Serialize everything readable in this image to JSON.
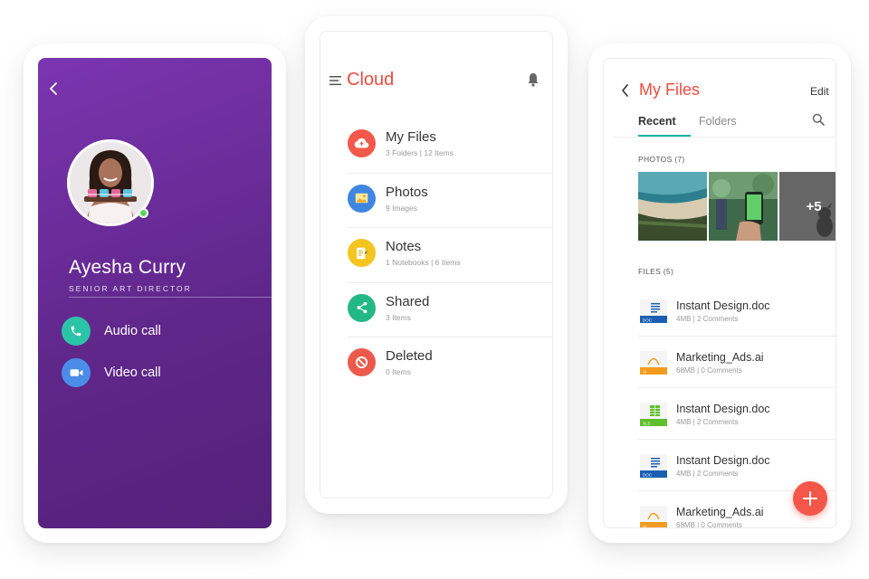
{
  "contact": {
    "name": "Ayesha Curry",
    "role": "SENIOR ART DIRECTOR",
    "online_color": "#5fd65b",
    "actions": [
      {
        "label": "Audio call",
        "icon": "phone-icon",
        "color": "#2cc4a7"
      },
      {
        "label": "Video call",
        "icon": "video-camera-icon",
        "color": "#4a8de8"
      }
    ]
  },
  "cloud": {
    "title": "Cloud",
    "accent": "#ef4b3f",
    "items": [
      {
        "name": "My Files",
        "details": "3 Folders  |  12 Items",
        "icon": "cloud-upload-icon",
        "color": "#f2594b"
      },
      {
        "name": "Photos",
        "details": "9 Images",
        "icon": "image-icon",
        "color": "#3f86e0"
      },
      {
        "name": "Notes",
        "details": "1 Notebooks  |  6 Items",
        "icon": "notepad-icon",
        "color": "#f4c41f"
      },
      {
        "name": "Shared",
        "details": "3 Items",
        "icon": "share-icon",
        "color": "#23b886"
      },
      {
        "name": "Deleted",
        "details": "0 Items",
        "icon": "block-icon",
        "color": "#ec5a4c"
      }
    ]
  },
  "files": {
    "title": "My Files",
    "edit_label": "Edit",
    "tabs": [
      {
        "label": "Recent",
        "active": true
      },
      {
        "label": "Folders",
        "active": false
      }
    ],
    "photos_header": "PHOTOS (7)",
    "more_photos": "+5",
    "files_header": "FILES (5)",
    "list": [
      {
        "name": "Instant Design.doc",
        "meta": "4MB  |  2 Comments",
        "type": "doc",
        "badge_color": "#1a5fb4"
      },
      {
        "name": "Marketing_Ads.ai",
        "meta": "68MB  |  0 Comments",
        "type": "ai",
        "badge_color": "#f39c1f"
      },
      {
        "name": "Instant Design.doc",
        "meta": "4MB  |  2 Comments",
        "type": "xls",
        "badge_color": "#5fbf2c"
      },
      {
        "name": "Instant Design.doc",
        "meta": "4MB  |  2 Comments",
        "type": "doc",
        "badge_color": "#1a5fb4"
      },
      {
        "name": "Marketing_Ads.ai",
        "meta": "68MB  |  0 Comments",
        "type": "ai",
        "badge_color": "#f39c1f"
      }
    ],
    "fab_color": "#f4564a"
  }
}
